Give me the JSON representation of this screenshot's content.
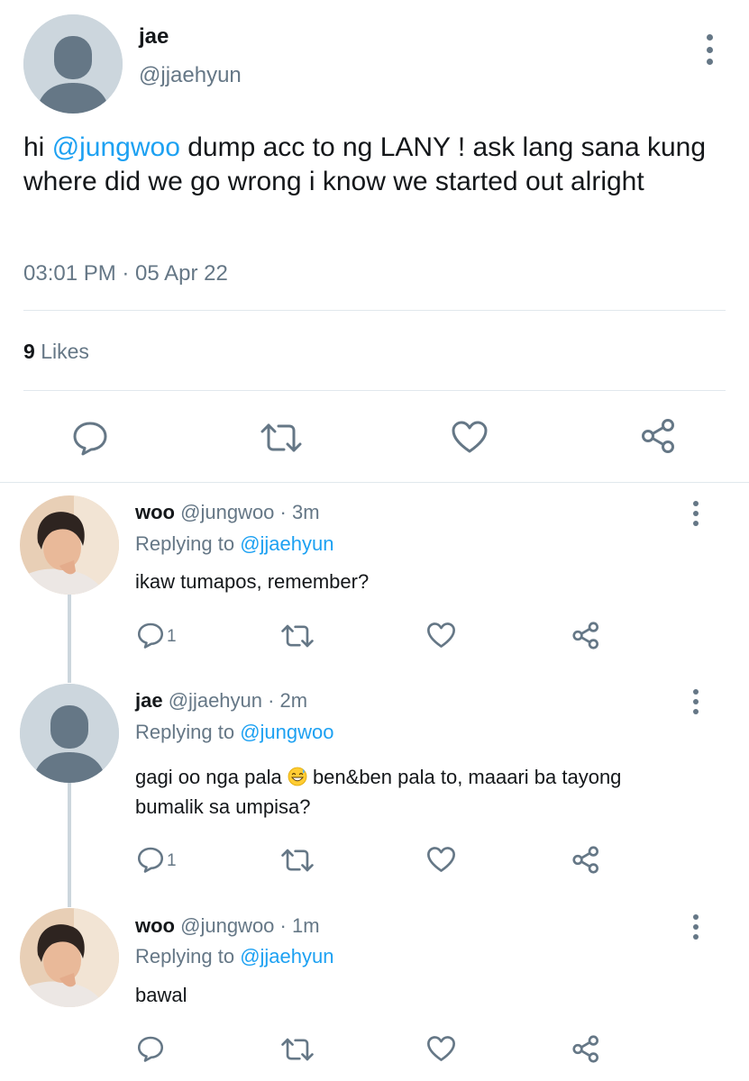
{
  "main_tweet": {
    "display_name": "jae",
    "handle": "@jjaehyun",
    "text_before": "hi ",
    "mention": "@jungwoo",
    "text_after": " dump acc to ng LANY ! ask lang sana kung where did we go wrong i know we started out alright",
    "timestamp": "03:01 PM · 05 Apr 22",
    "likes_count": "9",
    "likes_label": "Likes",
    "avatar_icon": "default-profile-icon"
  },
  "replies": [
    {
      "display_name": "woo",
      "meta": "@jungwoo · 3m",
      "replying_prefix": "Replying to ",
      "replying_to": "@jjaehyun",
      "text": "ikaw tumapos, remember?",
      "reply_count": "1",
      "avatar_icon": "photo-avatar"
    },
    {
      "display_name": "jae",
      "meta": "@jjaehyun · 2m",
      "replying_prefix": "Replying to ",
      "replying_to": "@jungwoo",
      "text_before_emoji": "gagi oo nga pala ",
      "emoji": "grinning-sweat-emoji",
      "text_after_emoji": " ben&ben pala to, maaari ba tayong bumalik sa umpisa?",
      "reply_count": "1",
      "avatar_icon": "default-profile-icon"
    },
    {
      "display_name": "woo",
      "meta": "@jungwoo · 1m",
      "replying_prefix": "Replying to ",
      "replying_to": "@jjaehyun",
      "text": "bawal",
      "reply_count": "",
      "avatar_icon": "photo-avatar"
    }
  ],
  "colors": {
    "link_blue": "#1da1f2",
    "secondary_gray": "#657786",
    "divider": "#e1e8ed",
    "avatar_bg": "#ccd6dd",
    "avatar_fg": "#657786"
  },
  "icons": {
    "reply": "speech-bubble-icon",
    "retweet": "retweet-icon",
    "like": "heart-icon",
    "share": "share-icon",
    "more": "vertical-dots-icon"
  }
}
